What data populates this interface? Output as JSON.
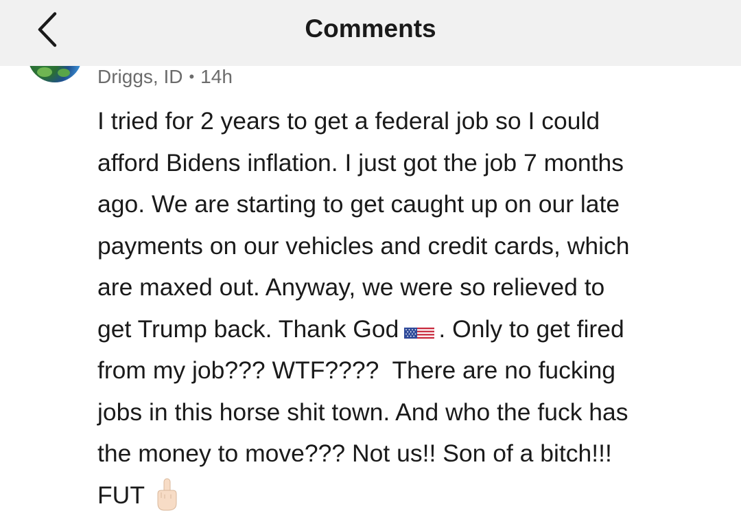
{
  "header": {
    "title": "Comments",
    "back_icon": "chevron-left-icon"
  },
  "comment": {
    "avatar_icon": "avatar-image",
    "location": "Driggs, ID",
    "separator": "•",
    "time": "14h",
    "lines": [
      "I tried for 2 years to get a federal job so I could",
      "afford Bidens inflation. I just got the job 7 months",
      "ago. We are starting to get caught up on our late",
      "payments on our vehicles and credit cards, which",
      "are maxed out. Anyway, we were so relieved to",
      "get Trump back. Thank God",
      ". Only to get fired",
      "from my job??? WTF????  There are no fucking",
      "jobs in this horse shit town. And who the fuck has",
      "the money to move??? Not us!! Son of a bitch!!!",
      "FUT"
    ],
    "emoji": {
      "flag": "us-flag-emoji",
      "gesture": "middle-finger-emoji"
    }
  },
  "colors": {
    "header_bg": "#f1f1f1",
    "text": "#1a1a1a",
    "meta_text": "#6b6b6b"
  }
}
